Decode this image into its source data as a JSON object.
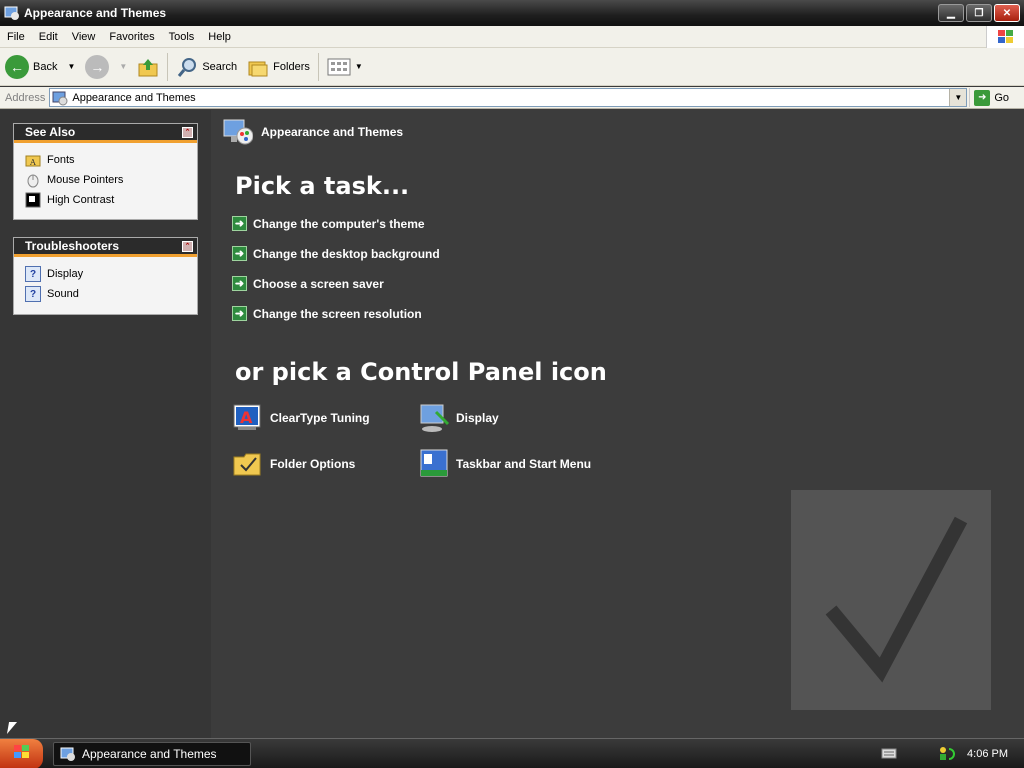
{
  "window": {
    "title": "Appearance and Themes",
    "icon": "control-panel-icon"
  },
  "menu": [
    "File",
    "Edit",
    "View",
    "Favorites",
    "Tools",
    "Help"
  ],
  "toolbar": {
    "back_label": "Back",
    "search_label": "Search",
    "folders_label": "Folders"
  },
  "address": {
    "label": "Address",
    "value": "Appearance and Themes",
    "go_label": "Go"
  },
  "see_also": {
    "title": "See Also",
    "items": [
      {
        "label": "Fonts",
        "icon": "fonts-folder-icon"
      },
      {
        "label": "Mouse Pointers",
        "icon": "mouse-icon"
      },
      {
        "label": "High Contrast",
        "icon": "high-contrast-icon"
      }
    ]
  },
  "troubleshooters": {
    "title": "Troubleshooters",
    "items": [
      {
        "label": "Display",
        "icon": "help-icon"
      },
      {
        "label": "Sound",
        "icon": "help-icon"
      }
    ]
  },
  "main": {
    "category_title": "Appearance and Themes",
    "pick_task_heading": "Pick a task...",
    "tasks": [
      "Change the computer's theme",
      "Change the desktop background",
      "Choose a screen saver",
      "Change the screen resolution"
    ],
    "pick_icon_heading": "or pick a Control Panel icon",
    "icons": [
      {
        "label": "ClearType Tuning",
        "icon": "cleartype-icon"
      },
      {
        "label": "Display",
        "icon": "display-icon"
      },
      {
        "label": "Folder Options",
        "icon": "folder-options-icon"
      },
      {
        "label": "Taskbar and Start Menu",
        "icon": "taskbar-icon"
      }
    ]
  },
  "taskbar": {
    "task_label": "Appearance and Themes",
    "clock": "4:06 PM"
  },
  "colors": {
    "main_bg": "#3c3c3c",
    "accent": "#f0a030",
    "task_arrow": "#2e8b3e"
  }
}
